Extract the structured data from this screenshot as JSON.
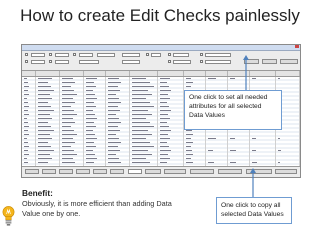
{
  "slide": {
    "title": "How to create Edit Checks painlessly"
  },
  "callouts": {
    "top": "One click to set all needed attributes for all selected Data Values",
    "bottom": "One click to copy all selected Data Values"
  },
  "benefit": {
    "heading": "Benefit:",
    "text": "Obviously, it is more efficient than adding Data Value one by one."
  },
  "colors": {
    "accent": "#4f81bd",
    "callout_border": "#6f9cd2",
    "bulb": "#f4b51c"
  },
  "icons": {
    "bulb": "lightbulb-icon"
  }
}
